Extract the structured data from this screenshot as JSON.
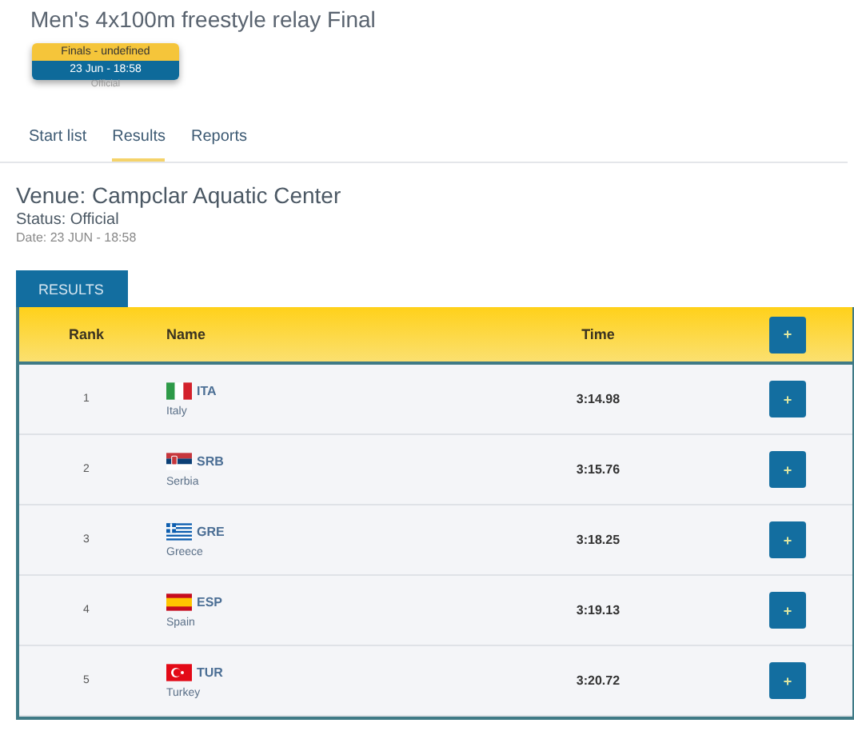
{
  "event": {
    "title": "Men's 4x100m freestyle relay Final",
    "badge": {
      "phase": "Finals - undefined",
      "date": "23 Jun - 18:58",
      "status": "Official"
    }
  },
  "tabs": [
    {
      "label": "Start list",
      "selected": false
    },
    {
      "label": "Results",
      "selected": true
    },
    {
      "label": "Reports",
      "selected": false
    }
  ],
  "venue": {
    "title": "Venue: Campclar Aquatic Center",
    "status": "Status: Official",
    "date": "Date: 23 JUN - 18:58"
  },
  "results": {
    "tab": "RESULTS",
    "columns": [
      "Rank",
      "Name",
      "Time"
    ],
    "header_button": "+",
    "rows": [
      {
        "rank": "1",
        "code": "ITA",
        "country": "Italy",
        "time": "3:14.98",
        "button": "+",
        "kind": "tricolor"
      },
      {
        "rank": "2",
        "code": "SRB",
        "country": "Serbia",
        "time": "3:15.76",
        "button": "+",
        "kind": "crested"
      },
      {
        "rank": "3",
        "code": "GRE",
        "country": "Greece",
        "time": "3:18.25",
        "button": "+",
        "kind": "striped"
      },
      {
        "rank": "4",
        "code": "ESP",
        "country": "Spain",
        "time": "3:19.13",
        "button": "+",
        "kind": "banded"
      },
      {
        "rank": "5",
        "code": "TUR",
        "country": "Turkey",
        "time": "3:20.72",
        "button": "+",
        "kind": "crescent"
      }
    ]
  }
}
